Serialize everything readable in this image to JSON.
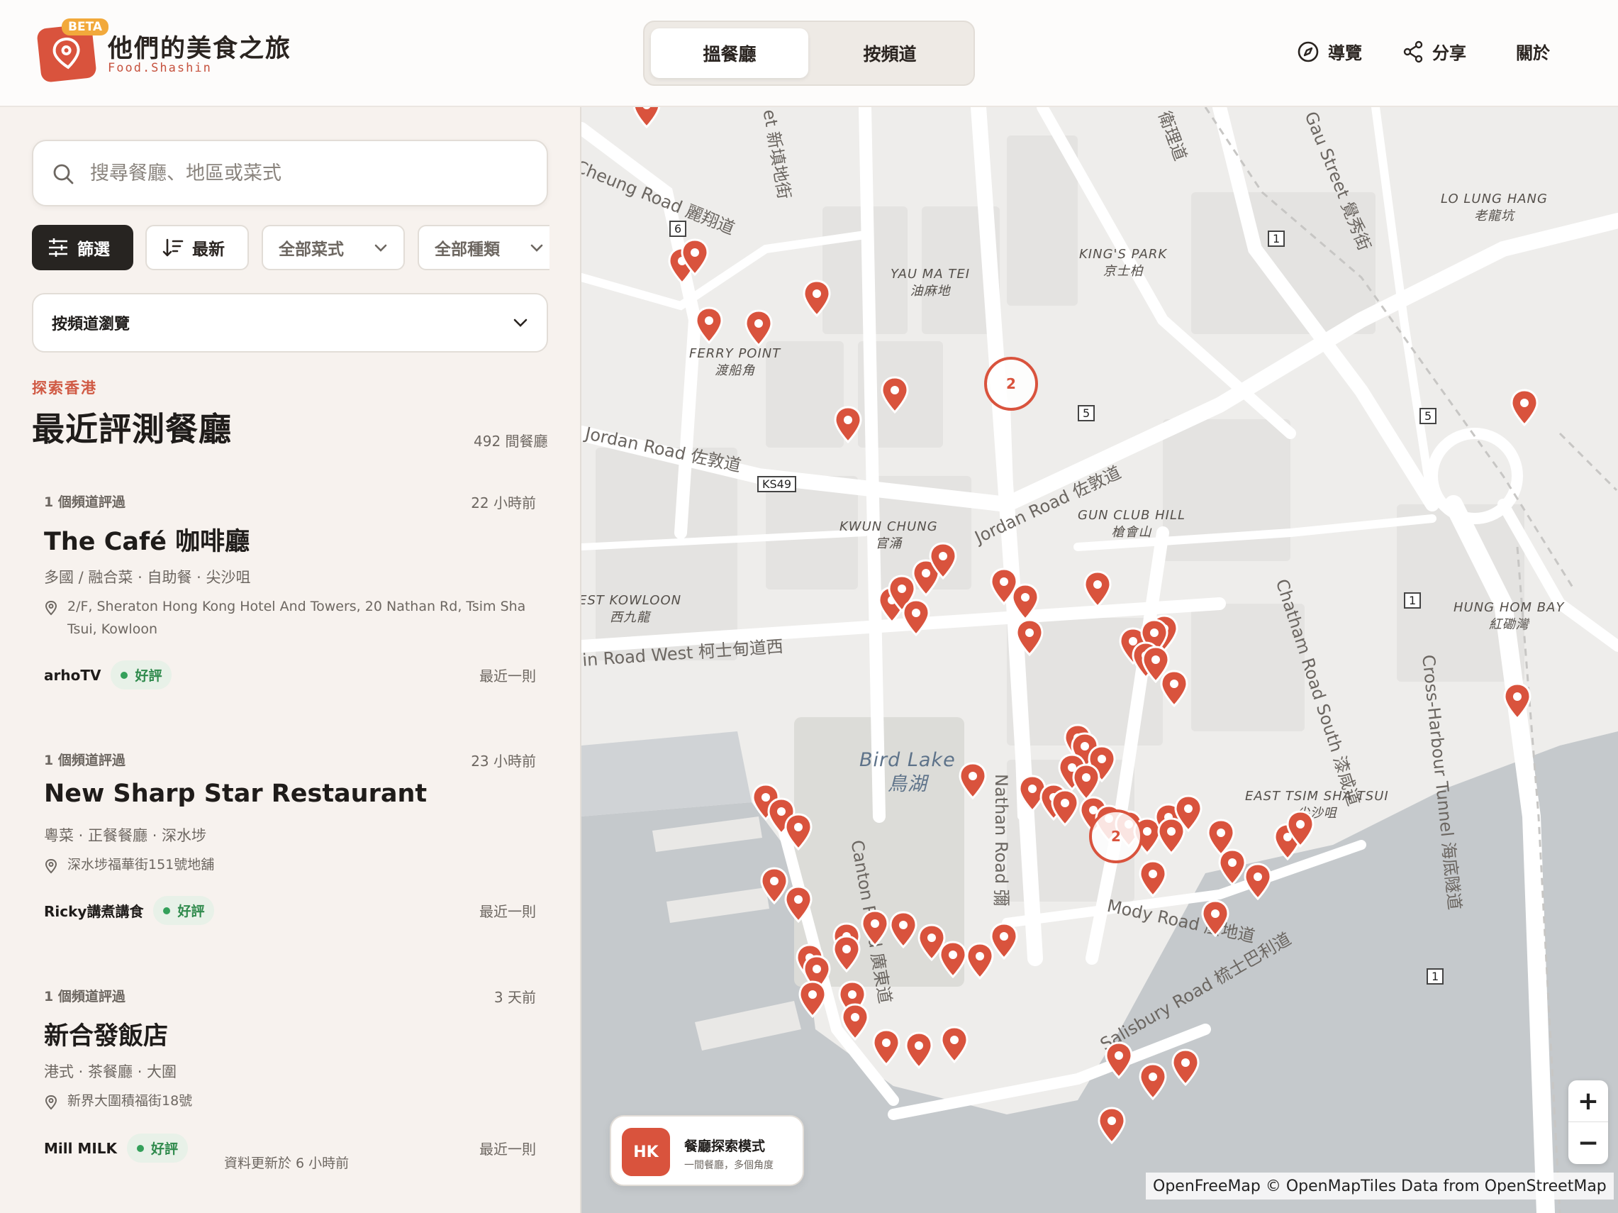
{
  "header": {
    "beta": "BETA",
    "brand_title": "他們的美食之旅",
    "brand_sub": "Food.Shashin",
    "tabs": [
      "搵餐廳",
      "按頻道"
    ],
    "nav": {
      "guide": "導覽",
      "share": "分享",
      "about": "關於"
    }
  },
  "sidebar": {
    "search_placeholder": "搜尋餐廳、地區或菜式",
    "chips": {
      "filter": "篩選",
      "sort": "最新",
      "cuisine": "全部菜式",
      "type": "全部種類"
    },
    "channel_browse": "按頻道瀏覽",
    "eyebrow": "探索香港",
    "section_title": "最近評測餐廳",
    "count": "492 間餐廳",
    "cards": [
      {
        "meta": "1 個頻道評過",
        "time": "22 小時前",
        "name": "The Café 咖啡廳",
        "tags": "多國 / 融合菜 · 自助餐 · 尖沙咀",
        "address": "2/F, Sheraton Hong Kong Hotel And Towers, 20 Nathan Rd, Tsim Sha Tsui, Kowloon",
        "channel": "arhoTV",
        "verdict": "好評",
        "latest": "最近一則"
      },
      {
        "meta": "1 個頻道評過",
        "time": "23 小時前",
        "name": "New Sharp Star Restaurant",
        "tags": "粵菜 · 正餐餐廳 · 深水埗",
        "address": "深水埗福華街151號地舖",
        "channel": "Ricky講煮講食",
        "verdict": "好評",
        "latest": "最近一則"
      },
      {
        "meta": "1 個頻道評過",
        "time": "3 天前",
        "name": "新合發飯店",
        "tags": "港式 · 茶餐廳 · 大圍",
        "address": "新界大圍積福街18號",
        "channel": "Mill MILK",
        "verdict": "好評",
        "latest": "最近一則"
      }
    ],
    "updated": "資料更新於 6 小時前"
  },
  "map": {
    "labels": [
      {
        "en": "YAU MA TEI",
        "zh": "油麻地"
      },
      {
        "en": "KING'S PARK",
        "zh": "京士柏"
      },
      {
        "en": "LO LUNG HANG",
        "zh": "老龍坑"
      },
      {
        "en": "FERRY POINT",
        "zh": "渡船角"
      },
      {
        "en": "KWUN CHUNG",
        "zh": "官涌"
      },
      {
        "en": "GUN CLUB HILL",
        "zh": "槍會山"
      },
      {
        "en": "EST KOWLOON",
        "zh": "西九龍"
      },
      {
        "en": "HUNG HOM BAY",
        "zh": "紅磡灣"
      },
      {
        "en": "EAST TSIM SHA TSUI",
        "zh": "尖沙咀"
      },
      {
        "en": "Bird Lake",
        "zh": "鳥湖"
      }
    ],
    "roads": [
      "Cheung Road 麗翔道",
      "Jordan Road 佐敦道",
      "Jordan Road 佐敦道",
      "in Road West 柯士甸道西",
      "Nathan Road 彌",
      "Canton Road 廣東道",
      "Chatham Road South 漆咸道",
      "Cross-Harbour Tunnel 海底隧道",
      "Mody Road 麼地道",
      "Salisbury Road 梳士巴利道",
      "et 新填地街",
      "衛理道",
      "Gau Street 覺秀街"
    ],
    "route_shields": [
      "6",
      "1",
      "5",
      "5",
      "KS49",
      "1",
      "1"
    ],
    "clusters": [
      "2",
      "2"
    ],
    "mode": {
      "badge": "HK",
      "title": "餐廳探索模式",
      "subtitle": "一間餐廳，多個角度"
    },
    "zoom_in": "+",
    "zoom_out": "−",
    "attribution": "OpenFreeMap © OpenMapTiles Data from OpenStreetMap"
  },
  "colors": {
    "accent": "#d9533d",
    "good": "#2f8a4c",
    "dark": "#272421"
  }
}
